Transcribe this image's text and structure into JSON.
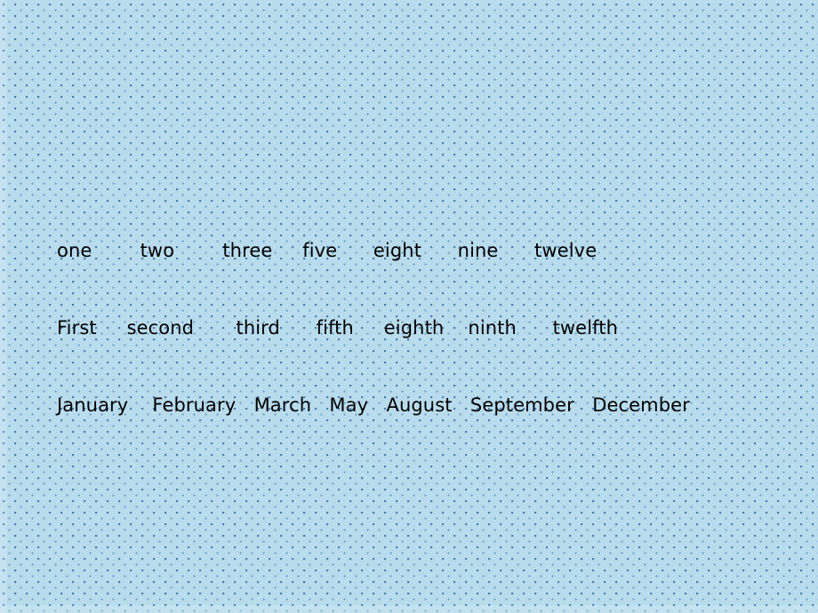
{
  "slide": {
    "background_color": "#b9dced",
    "dot_color": "#4a7db5",
    "text_color": "#000000",
    "rows": [
      {
        "name": "cardinal-numbers",
        "text": "one        two        three     five      eight      nine      twelve",
        "words": [
          "one",
          "two",
          "three",
          "five",
          "eight",
          "nine",
          "twelve"
        ]
      },
      {
        "name": "ordinal-numbers",
        "text": "First     second       third      fifth     eighth    ninth      twelfth",
        "words": [
          "First",
          "second",
          "third",
          "fifth",
          "eighth",
          "ninth",
          "twelfth"
        ]
      },
      {
        "name": "months",
        "text": "January    February   March   May   August   September   December",
        "words": [
          "January",
          "February",
          "March",
          "May",
          "August",
          "September",
          "December"
        ]
      }
    ]
  }
}
